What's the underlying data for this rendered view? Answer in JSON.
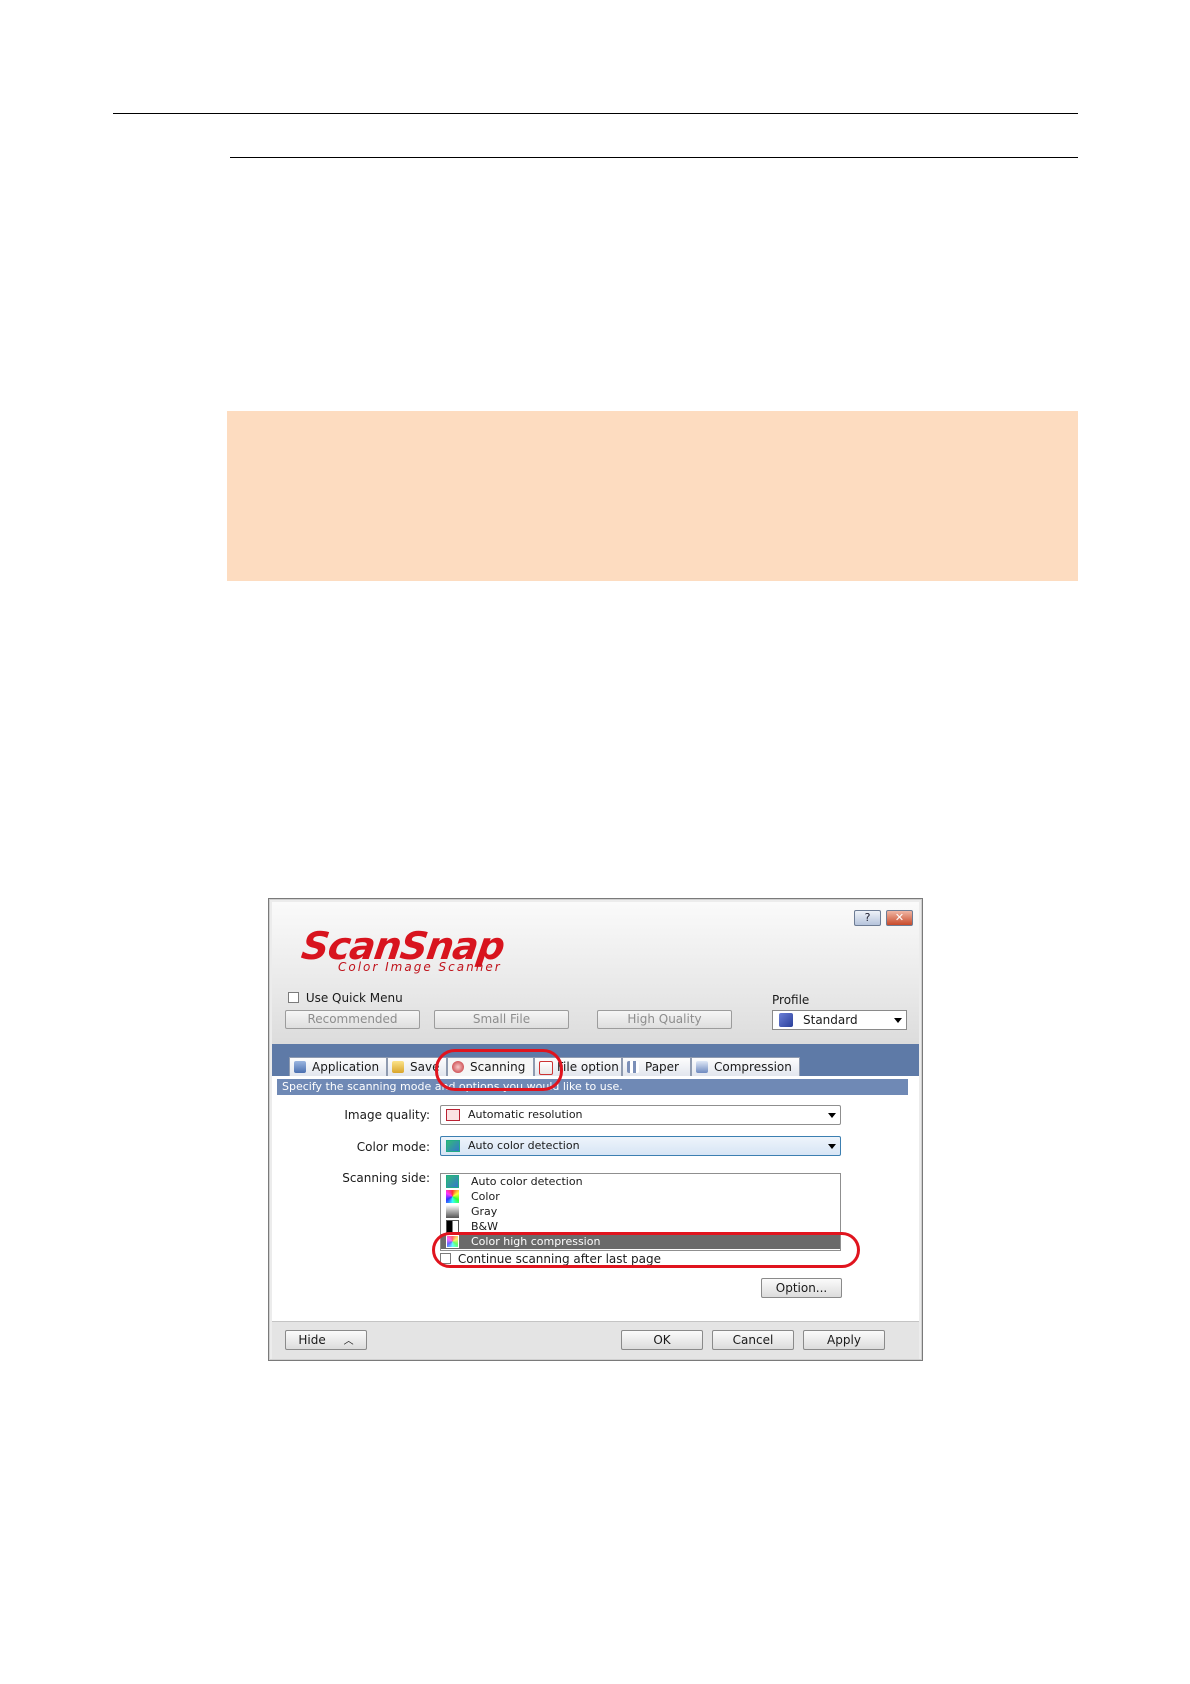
{
  "dialog": {
    "title_buttons": {
      "help": "?",
      "close": "✕"
    },
    "logo": {
      "main": "ScanSnap",
      "sub": "Color Image Scanner"
    },
    "quick_menu_label": "Use Quick Menu",
    "profile_label": "Profile",
    "presets": [
      "Recommended",
      "Small File",
      "High Quality"
    ],
    "profile_value": "Standard",
    "tabs": [
      "Application",
      "Save",
      "Scanning",
      "File option",
      "Paper",
      "Compression"
    ],
    "active_tab": "Scanning",
    "info_bar": "Specify the scanning mode and options you would like to use.",
    "image_quality_label": "Image quality:",
    "image_quality_value": "Automatic resolution",
    "color_mode_label": "Color mode:",
    "color_mode_value": "Auto color detection",
    "scanning_side_label": "Scanning side:",
    "color_mode_options": [
      "Auto color detection",
      "Color",
      "Gray",
      "B&W",
      "Color high compression"
    ],
    "selected_option": "Color high compression",
    "continue_label": "Continue scanning after last page",
    "option_button": "Option...",
    "footer": {
      "hide": "Hide",
      "ok": "OK",
      "cancel": "Cancel",
      "apply": "Apply"
    }
  },
  "colors": {
    "note_background": "#fddcc0",
    "highlight": "#e0141e",
    "tab_strip": "#5e7aa7",
    "logo_red": "#d8141e"
  }
}
